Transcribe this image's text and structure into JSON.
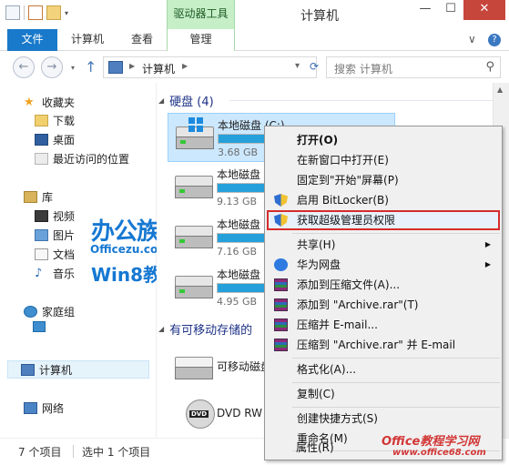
{
  "window": {
    "title": "计算机",
    "context_tab_header": "驱动器工具",
    "minimize": "—",
    "maximize": "☐",
    "close": "✕"
  },
  "ribbon": {
    "tabs": [
      "文件",
      "计算机",
      "查看",
      "管理"
    ],
    "collapse": "∨",
    "help": "?"
  },
  "address": {
    "path_root": "计算机",
    "chevron": "▶",
    "dropdown": "▾",
    "search_placeholder": "搜索 计算机"
  },
  "nav": {
    "favorites": "收藏夹",
    "downloads": "下载",
    "desktop": "桌面",
    "recent": "最近访问的位置",
    "libraries": "库",
    "videos": "视频",
    "pictures": "图片",
    "documents": "文档",
    "music": "音乐",
    "homegroup": "家庭组",
    "computer": "计算机",
    "network": "网络"
  },
  "watermark": {
    "brand": "办公族",
    "domain": "Officezu.com",
    "tutorial": "Win8教程",
    "site_name": "Office教程学习网",
    "site_url": "www.office68.com"
  },
  "content": {
    "group_hard_disks": "硬盘 (4)",
    "group_removable": "有可移动存储的",
    "drives": [
      {
        "name": "本地磁盘 (C:)",
        "size": "3.68 GB",
        "used_fraction": 0.55
      },
      {
        "name": "本地磁盘",
        "size": "9.13 GB",
        "used_fraction": 0.3
      },
      {
        "name": "本地磁盘",
        "size": "7.16 GB",
        "used_fraction": 0.35
      },
      {
        "name": "本地磁盘",
        "size": "4.95 GB",
        "used_fraction": 0.4
      }
    ],
    "removable": [
      {
        "name": "可移动磁盘"
      },
      {
        "name": "DVD RW"
      }
    ],
    "dvd_label": "DVD"
  },
  "status": {
    "item_count": "7 个项目",
    "selected": "选中 1 个项目"
  },
  "context_menu": {
    "items": [
      {
        "label": "打开(O)"
      },
      {
        "label": "在新窗口中打开(E)"
      },
      {
        "label": "固定到\"开始\"屏幕(P)"
      },
      {
        "label": "启用 BitLocker(B)"
      },
      {
        "label": "获取超级管理员权限"
      },
      {
        "label": "共享(H)"
      },
      {
        "label": "华为网盘"
      },
      {
        "label": "添加到压缩文件(A)..."
      },
      {
        "label": "添加到 \"Archive.rar\"(T)"
      },
      {
        "label": "压缩并 E-mail..."
      },
      {
        "label": "压缩到 \"Archive.rar\" 并 E-mail"
      },
      {
        "label": "格式化(A)..."
      },
      {
        "label": "复制(C)"
      },
      {
        "label": "创建快捷方式(S)"
      },
      {
        "label": "重命名(M)"
      },
      {
        "label": "属性(R)"
      }
    ],
    "submenu_arrow": "▶"
  },
  "colors": {
    "accent": "#1979ca",
    "context_tab": "#c6efc8",
    "selection": "#cce8ff",
    "highlight_border": "#d62b2b",
    "close_button": "#c7463b"
  }
}
